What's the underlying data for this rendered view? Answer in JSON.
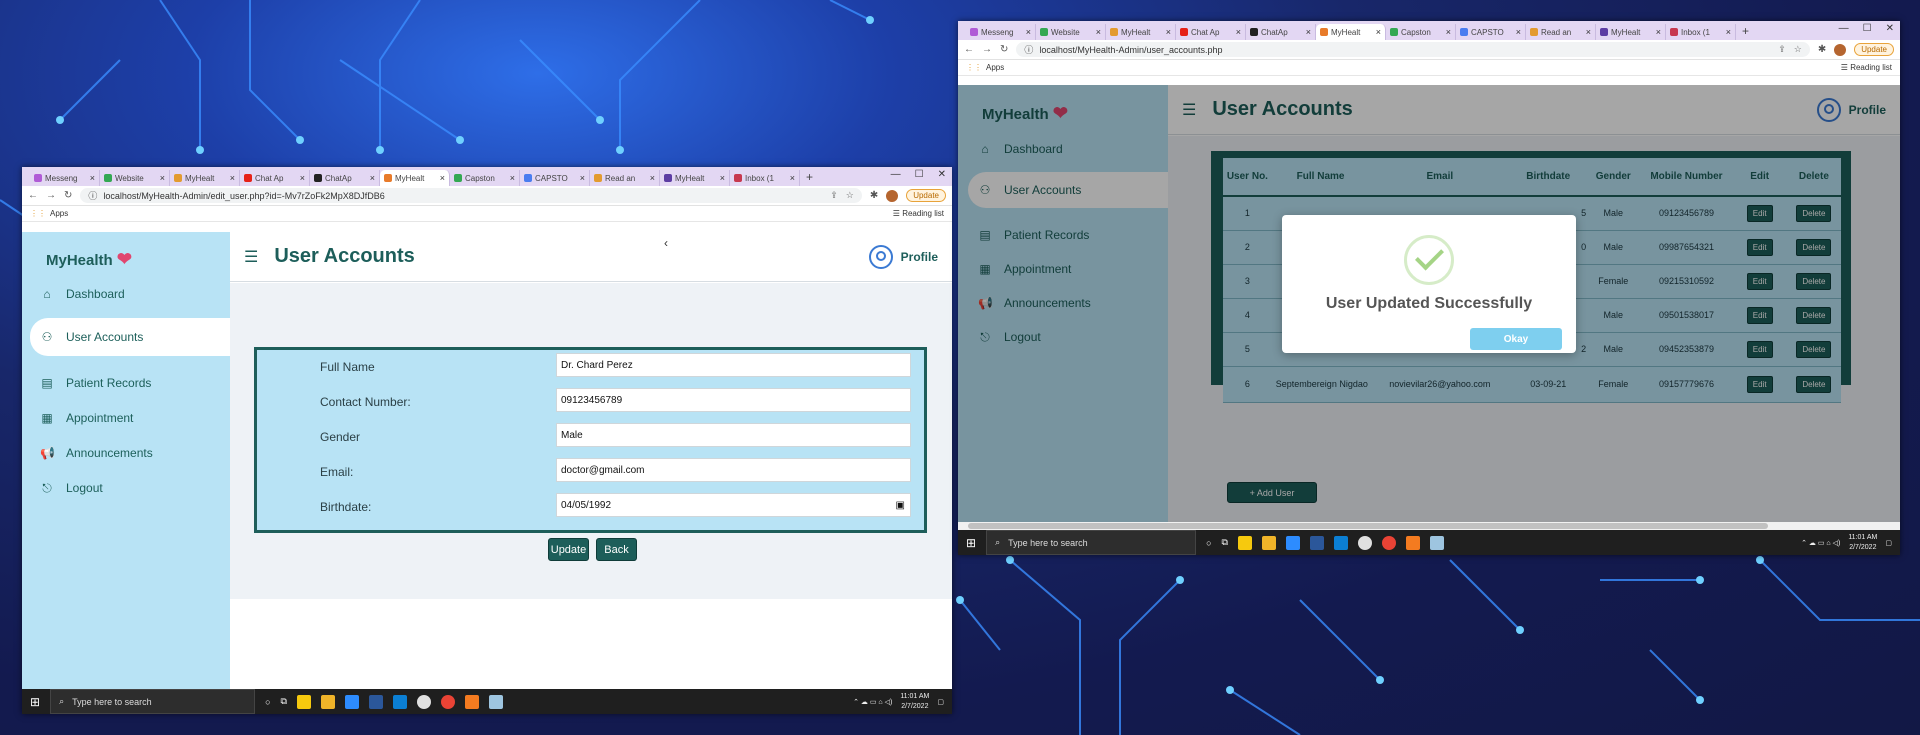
{
  "taskbar": {
    "search_placeholder": "Type here to search",
    "time": "11:01 AM",
    "date": "2/7/2022"
  },
  "browser": {
    "tabs": [
      "Messeng",
      "Website",
      "MyHealt",
      "Chat Ap",
      "ChatAp",
      "MyHealt",
      "Capston",
      "CAPSTO",
      "Read an",
      "MyHealt",
      "Inbox (1"
    ],
    "tab_colors": [
      "#b05bd6",
      "#34a853",
      "#e39b2f",
      "#e62117",
      "#222222",
      "#e87b2a",
      "#34a853",
      "#4a7df0",
      "#e39b2f",
      "#5d3da3",
      "#c7384f"
    ],
    "apps_label": "Apps",
    "reading_list": "Reading list",
    "update_label": "Update"
  },
  "left_window": {
    "url": "localhost/MyHealth-Admin/edit_user.php?id=-Mv7rZoFk2MpX8DJfDB6",
    "collapse_glyph": "‹",
    "form": {
      "fields": [
        {
          "label": "Full Name",
          "value": "Dr. Chard Perez"
        },
        {
          "label": "Contact Number:",
          "value": "09123456789"
        },
        {
          "label": "Gender",
          "value": "Male"
        },
        {
          "label": "Email:",
          "value": "doctor@gmail.com"
        },
        {
          "label": "Birthdate:",
          "value": "04/05/1992"
        }
      ],
      "update_label": "Update",
      "back_label": "Back"
    }
  },
  "right_window": {
    "url": "localhost/MyHealth-Admin/user_accounts.php",
    "table": {
      "headers": [
        "User No.",
        "Full Name",
        "Email",
        "Birthdate",
        "Gender",
        "Mobile Number",
        "Edit",
        "Delete"
      ],
      "rows": [
        {
          "no": "1",
          "name": "",
          "email": "",
          "birth": "5",
          "gender": "Male",
          "mobile": "09123456789"
        },
        {
          "no": "2",
          "name": "",
          "email": "",
          "birth": "0",
          "gender": "Male",
          "mobile": "09987654321"
        },
        {
          "no": "3",
          "name": "",
          "email": "",
          "birth": "",
          "gender": "Female",
          "mobile": "09215310592"
        },
        {
          "no": "4",
          "name": "",
          "email": "",
          "birth": "",
          "gender": "Male",
          "mobile": "09501538017"
        },
        {
          "no": "5",
          "name": "",
          "email": "",
          "birth": "2",
          "gender": "Male",
          "mobile": "09452353879"
        },
        {
          "no": "6",
          "name": "Septembereign Nigdao",
          "email": "novievilar26@yahoo.com",
          "birth": "03-09-21",
          "gender": "Female",
          "mobile": "09157779676"
        }
      ],
      "edit_label": "Edit",
      "delete_label": "Delete"
    },
    "add_user_label": "+ Add User",
    "modal": {
      "message": "User Updated Successfully",
      "ok_label": "Okay"
    }
  },
  "app": {
    "logo": "MyHealth",
    "page_title": "User Accounts",
    "profile_label": "Profile",
    "nav": [
      {
        "label": "Dashboard",
        "icon": "home-icon"
      },
      {
        "label": "User Accounts",
        "icon": "users-icon"
      },
      {
        "label": "Patient Records",
        "icon": "clipboard-icon"
      },
      {
        "label": "Appointment",
        "icon": "calendar-icon"
      },
      {
        "label": "Announcements",
        "icon": "megaphone-icon"
      },
      {
        "label": "Logout",
        "icon": "logout-icon"
      }
    ]
  },
  "colors": {
    "primary": "#1d5e5a",
    "sidebar": "#b8e3f5",
    "modal_ok": "#7ecfef",
    "check": "#a5d486"
  }
}
